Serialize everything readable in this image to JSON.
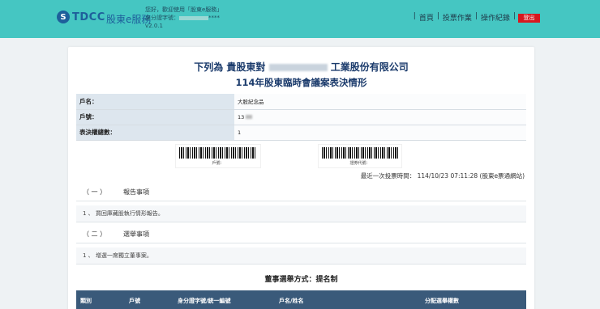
{
  "header": {
    "brand": "TDCC",
    "app_name": "股東e服務",
    "greeting": "您好，歡迎使用「股東e服務」",
    "id_label": "身分證字號：",
    "id_masked": "****",
    "version": "v2.0.1",
    "nav": [
      "首頁",
      "投票作業",
      "操作紀錄"
    ],
    "logout": "登出",
    "colors": {
      "bar": "#45c6c2",
      "logout": "#d7181f",
      "brand": "#1e5f9b"
    }
  },
  "page": {
    "title_prefix": "下列為 貴股東對",
    "title_suffix": "工業股份有限公司",
    "subtitle": "114年股東臨時會議案表決情形"
  },
  "info": {
    "rows": [
      {
        "label": "戶名：",
        "value": "大股紀念品"
      },
      {
        "label": "戶號：",
        "value": "13"
      },
      {
        "label": "表決權總數：",
        "value": "1"
      }
    ]
  },
  "barcodes": {
    "left_label": "戶號：",
    "right_label": "證券代號："
  },
  "last_vote": "最近一次投票時間： 114/10/23 07:11:28 (股東e票通網站)",
  "sections": [
    {
      "num": "（ 一 ）",
      "title": "報告事項",
      "item": "1 、 買回庫藏股執行情形報告。"
    },
    {
      "num": "（ 二 ）",
      "title": "選舉事項",
      "item": "1 、 增選一席獨立董事案。"
    }
  ],
  "election": {
    "title": "董事選舉方式：提名制",
    "columns": [
      "類別",
      "戶號",
      "身分證字號/統一編號",
      "戶名/姓名",
      "分配選舉權數"
    ]
  }
}
